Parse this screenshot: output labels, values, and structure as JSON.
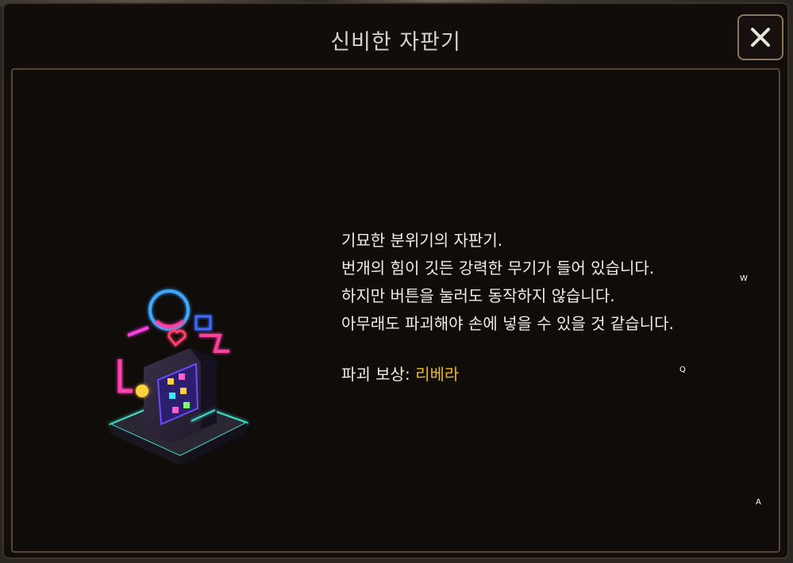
{
  "dialog": {
    "title": "신비한 자판기",
    "close_icon": "close-icon"
  },
  "item": {
    "image_icon": "neon-vending-machine-icon",
    "description_lines": [
      "기묘한 분위기의 자판기.",
      "번개의 힘이 깃든 강력한 무기가 들어 있습니다.",
      "하지만 버튼을 눌러도 동작하지 않습니다.",
      "아무래도 파괴해야 손에 넣을 수 있을 것 같습니다."
    ],
    "reward_label": "파괴 보상: ",
    "reward_value": "리베라"
  },
  "key_hints": {
    "w": "W",
    "q": "Q",
    "a": "A"
  },
  "colors": {
    "background": "#100d0b",
    "frame_border": "#5a4432",
    "close_border": "#8a7762",
    "text": "#f1ece4",
    "reward_highlight": "#f0b51e",
    "title": "#d9d2c8"
  }
}
